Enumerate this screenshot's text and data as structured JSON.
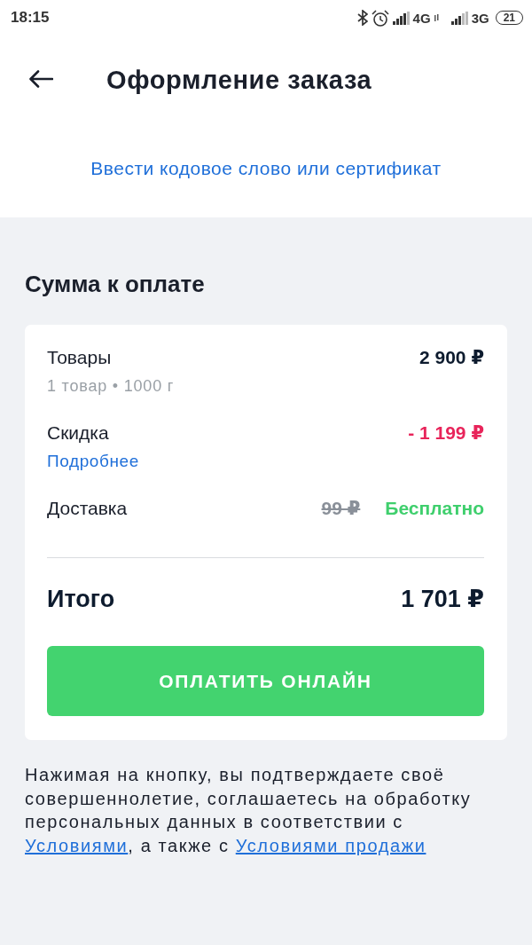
{
  "status_bar": {
    "time": "18:15",
    "network_1": "4G",
    "network_2": "3G",
    "battery": "21"
  },
  "header": {
    "title": "Оформление заказа"
  },
  "promo_link": "Ввести кодовое слово или сертификат",
  "summary": {
    "title": "Сумма к оплате",
    "rows": [
      {
        "kind": "items",
        "label": "Товары",
        "sublabel": "1 товар • 1000 г",
        "amount": "2 900 ₽"
      },
      {
        "kind": "discount",
        "label": "Скидка",
        "link": "Подробнее",
        "amount": "- 1 199 ₽"
      },
      {
        "kind": "delivery",
        "label": "Доставка",
        "old_amount": "99 ₽",
        "amount": "Бесплатно"
      }
    ],
    "total": {
      "label": "Итого",
      "amount": "1 701 ₽"
    },
    "pay_button": "ОПЛАТИТЬ ОНЛАЙН"
  },
  "disclaimer": [
    {
      "kind": "text",
      "text": "Нажимая на кнопку, вы подтверждаете своё совершеннолетие, соглашаетесь на обработку персональных данных в соответствии с "
    },
    {
      "kind": "link",
      "text": "Условиями"
    },
    {
      "kind": "text",
      "text": ", а также с "
    },
    {
      "kind": "link",
      "text": "Условиями продажи"
    }
  ]
}
